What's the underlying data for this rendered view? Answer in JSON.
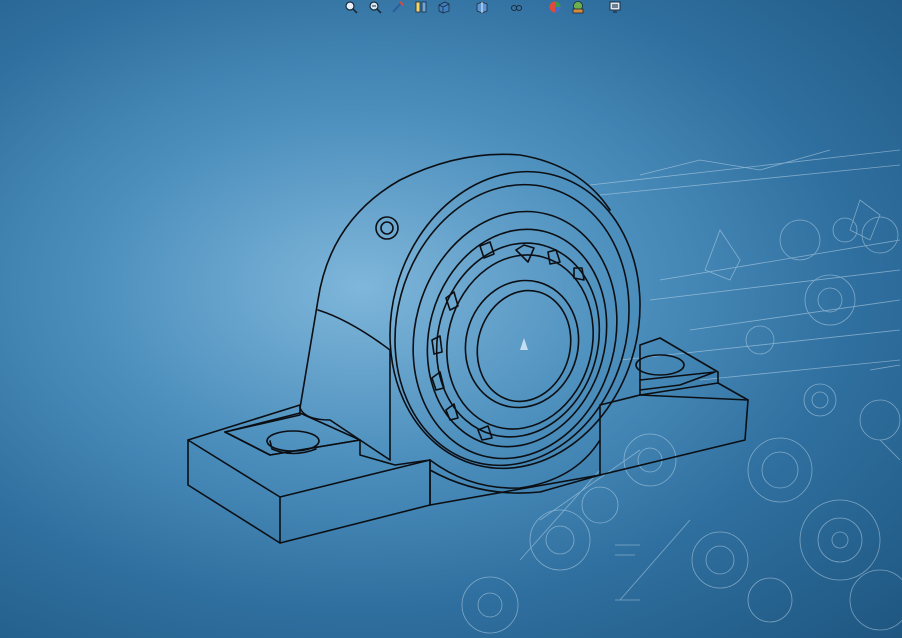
{
  "viewport": {
    "background_top": "#2f6f9f",
    "background_center": "#7fb6da",
    "line_color": "#0b0f14",
    "blueprint_line_color": "#dfeefa"
  },
  "toolbar": {
    "buttons": [
      {
        "icon": "zoom-to-fit-icon"
      },
      {
        "icon": "zoom-area-icon"
      },
      {
        "icon": "previous-view-icon"
      },
      {
        "icon": "section-view-icon"
      },
      {
        "icon": "view-orientation-icon"
      },
      {
        "icon": "display-style-icon"
      },
      {
        "icon": "hide-show-items-icon"
      },
      {
        "icon": "edit-appearance-icon"
      },
      {
        "icon": "apply-scene-icon"
      },
      {
        "icon": "view-settings-icon"
      }
    ]
  }
}
